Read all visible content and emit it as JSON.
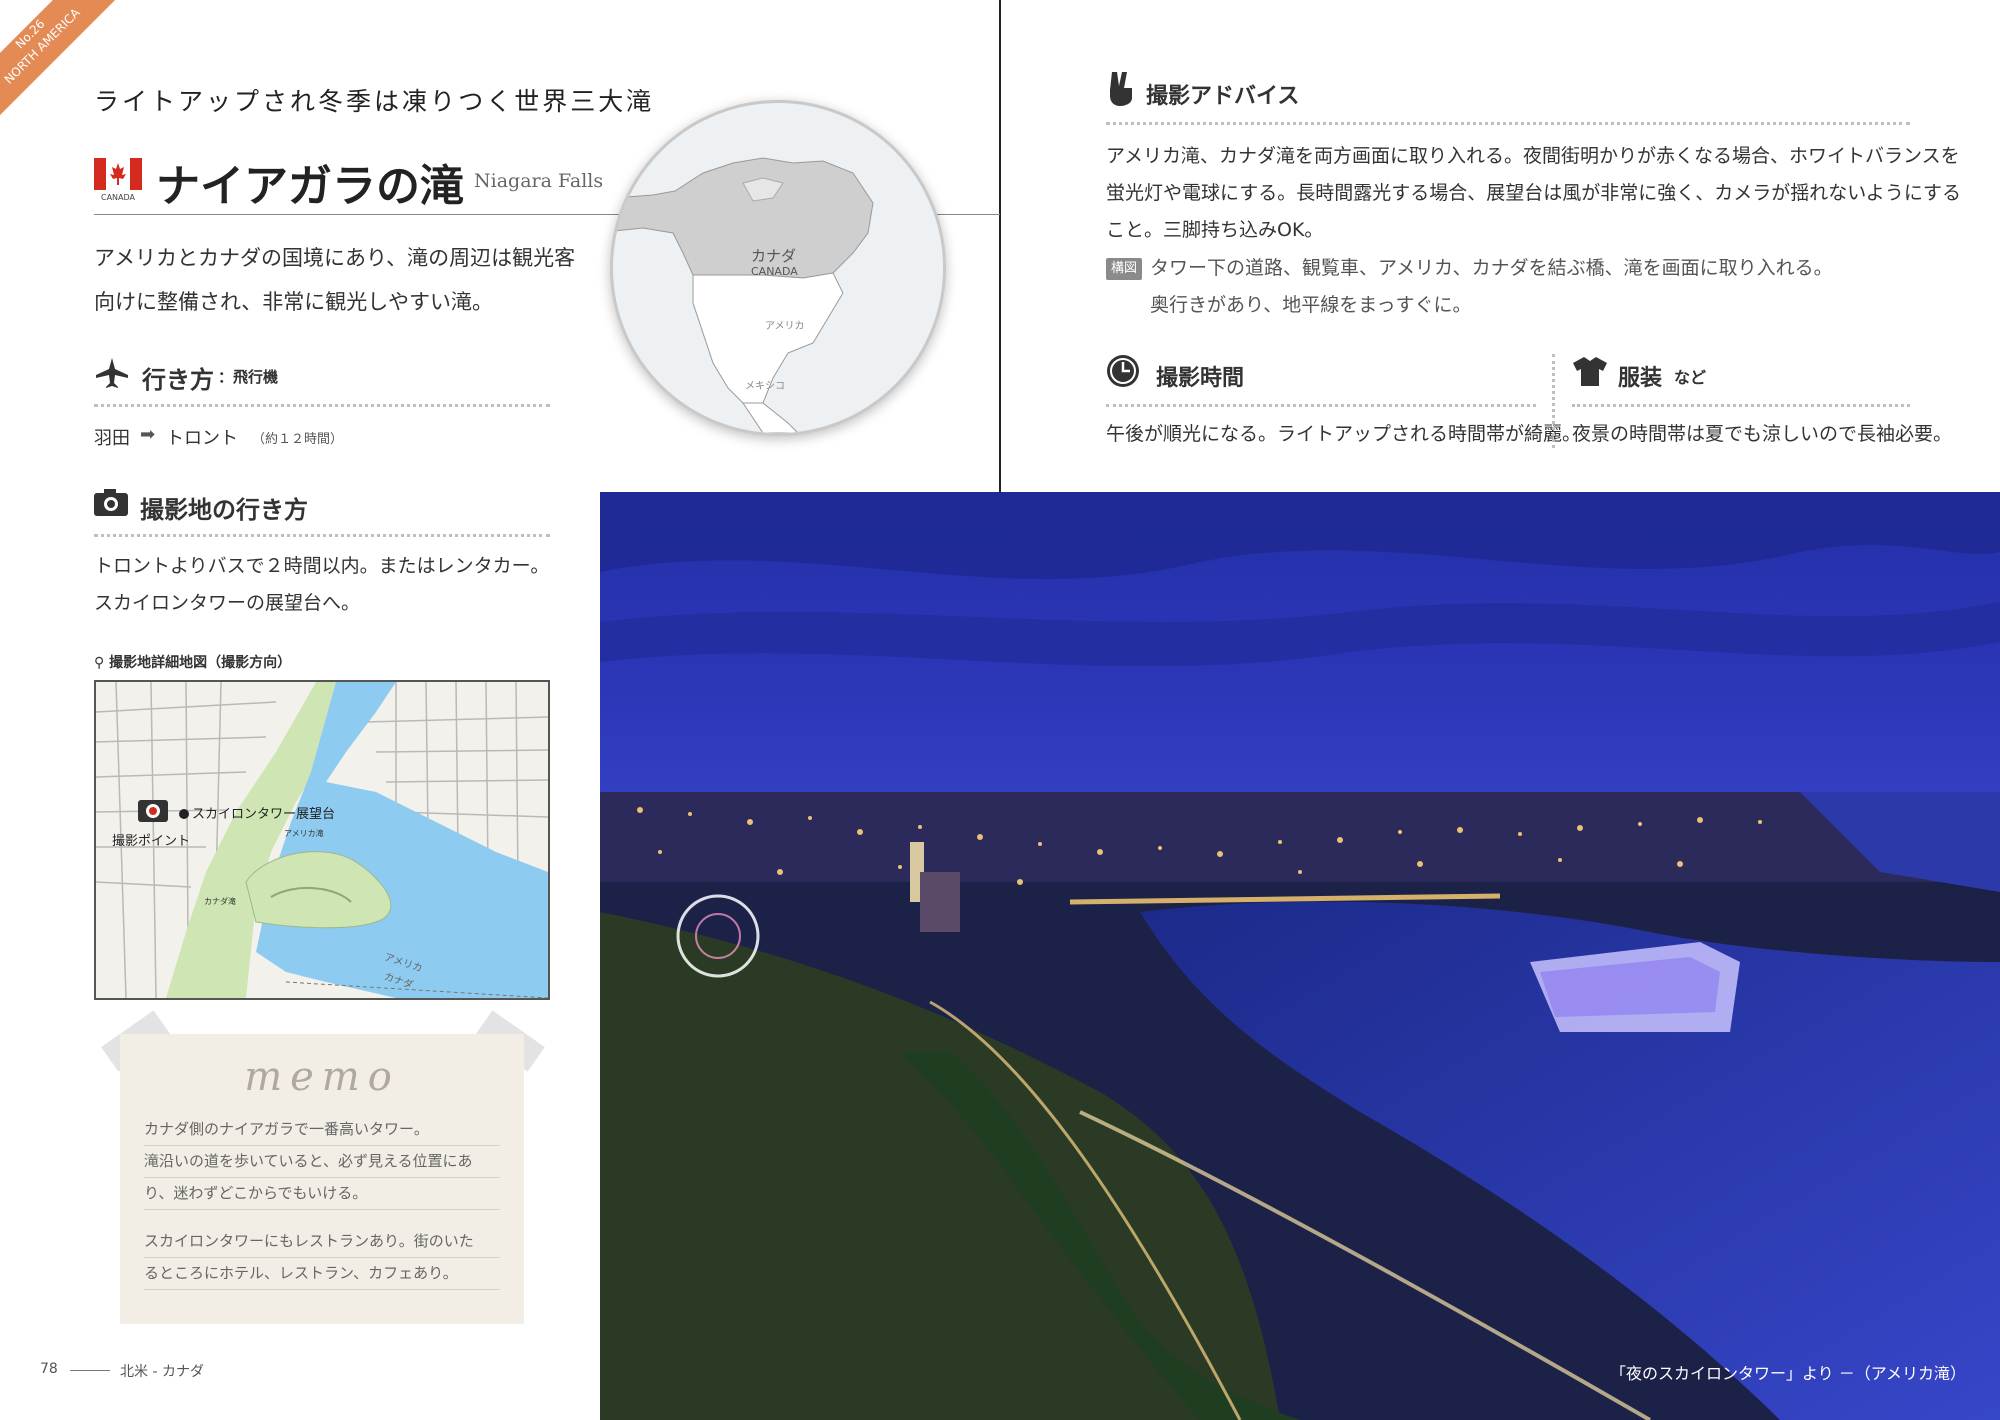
{
  "corner": {
    "number": "No.26",
    "region": "NORTH AMERICA"
  },
  "tagline": "ライトアップされ冬季は凍りつく世界三大滝",
  "flag_label": "CANADA",
  "title": "ナイアガラの滝",
  "title_en": "Niagara Falls",
  "intro": [
    "アメリカとカナダの国境にあり、滝の周辺は観光客",
    "向けに整備され、非常に観光しやすい滝。"
  ],
  "globe": {
    "canada": "カナダ",
    "canada_en": "CANADA",
    "usa": "アメリカ",
    "mexico": "メキシコ"
  },
  "access": {
    "heading": "行き方",
    "sub": "：飛行機",
    "from": "羽田",
    "to": "トロント",
    "time": "（約１２時間）"
  },
  "location": {
    "heading": "撮影地の行き方",
    "lines": [
      "トロントよりバスで２時間以内。またはレンタカー。",
      "スカイロンタワーの展望台へ。"
    ]
  },
  "detail_map": {
    "label": "撮影地詳細地図（撮影方向）",
    "tower": "スカイロンタワー展望台",
    "point": "撮影ポイント",
    "american_falls": "アメリカ滝",
    "canadian_falls": "カナダ滝",
    "border_usa": "アメリカ",
    "border_canada": "カナダ"
  },
  "memo": {
    "title": "memo",
    "lines": [
      "カナダ側のナイアガラで一番高いタワー。",
      "滝沿いの道を歩いていると、必ず見える位置にあ",
      "り、迷わずどこからでもいける。",
      "スカイロンタワーにもレストランあり。街のいた",
      "るところにホテル、レストラン、カフェあり。"
    ]
  },
  "footer": {
    "page": "78",
    "section": "北米 - カナダ"
  },
  "advice": {
    "heading": "撮影アドバイス",
    "lines": [
      "アメリカ滝、カナダ滝を両方画面に取り入れる。夜間街明かりが赤くなる場合、ホワイトバランスを",
      "蛍光灯や電球にする。長時間露光する場合、展望台は風が非常に強く、カメラが揺れないようにする",
      "こと。三脚持ち込みOK。"
    ],
    "comp_badge": "構図",
    "comp_lines": [
      "タワー下の道路、観覧車、アメリカ、カナダを結ぶ橋、滝を画面に取り入れる。",
      "奥行きがあり、地平線をまっすぐに。"
    ]
  },
  "time": {
    "heading": "撮影時間",
    "text": "午後が順光になる。ライトアップされる時間帯が綺麗。"
  },
  "clothing": {
    "heading": "服装",
    "suffix": "など",
    "text": "夜景の時間帯は夏でも涼しいので長袖必要。"
  },
  "caption": "「夜のスカイロンタワー」より －（アメリカ滝）",
  "colors": {
    "accent": "#e48a55",
    "flag_red": "#d52b1e",
    "photo_sky": "#2a2f9e",
    "water": "#8ecbf0",
    "park": "#cfe5b4"
  }
}
